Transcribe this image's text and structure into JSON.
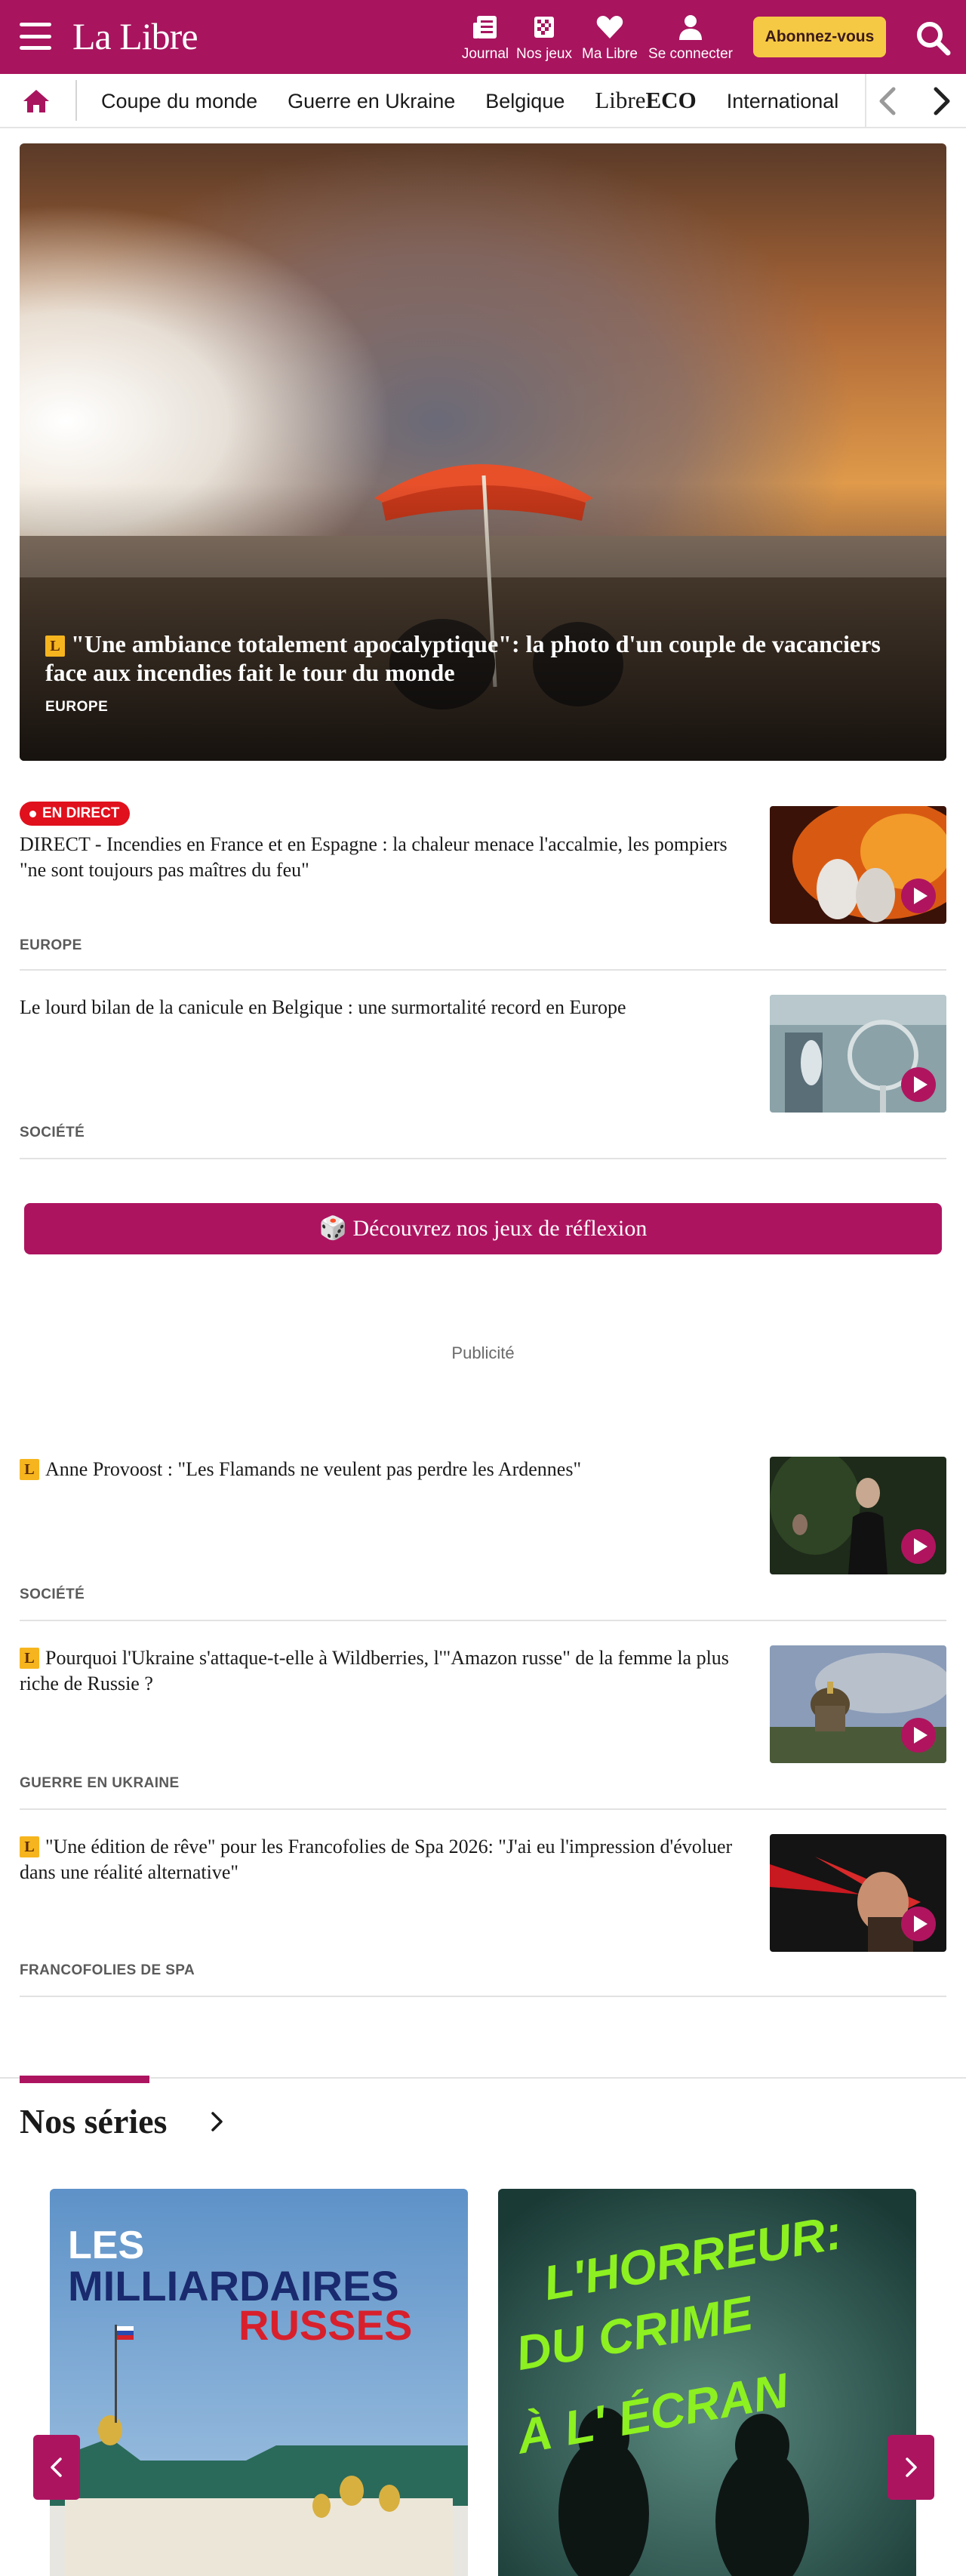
{
  "header": {
    "logo": "La Libre",
    "tools": [
      {
        "label": "Journal",
        "icon": "newspaper-icon"
      },
      {
        "label": "Nos jeux",
        "icon": "games-grid-icon"
      },
      {
        "label": "Ma Libre",
        "icon": "heart-icon"
      },
      {
        "label": "Se connecter",
        "icon": "user-icon"
      }
    ],
    "subscribe": "Abonnez-vous",
    "search_icon": "search-icon",
    "menu_icon": "hamburger-menu-icon",
    "colors": {
      "brand": "#a8145e",
      "accent": "#f6c945"
    }
  },
  "nav": {
    "home_icon": "home-icon",
    "items": [
      "Coupe du monde",
      "Guerre en Ukraine",
      "Belgique",
      "Libre",
      "ECO",
      "International"
    ],
    "prev_icon": "chevron-left-icon",
    "next_icon": "chevron-right-icon"
  },
  "hero": {
    "badge": "L",
    "title": "\"Une ambiance totalement apocalyptique\": la photo d'un couple de vacanciers face aux incendies fait le tour du monde",
    "category": "EUROPE"
  },
  "articles": [
    {
      "live": "EN DIRECT",
      "title": "DIRECT - Incendies en France et en Espagne : la chaleur menace l'accalmie, les pompiers \"ne sont toujours pas maîtres du feu\"",
      "category": "EUROPE"
    },
    {
      "title": "Le lourd bilan de la canicule en Belgique : une surmortalité record en Europe",
      "category": "SOCIÉTÉ"
    },
    {
      "badge": "L",
      "title": "Anne Provoost : \"Les Flamands ne veulent pas perdre les Ardennes\"",
      "category": "SOCIÉTÉ"
    },
    {
      "badge": "L",
      "title": "Pourquoi l'Ukraine s'attaque-t-elle à Wildberries, l'\"Amazon russe\" de la femme la plus riche de Russie ?",
      "category": "GUERRE EN UKRAINE"
    },
    {
      "badge": "L",
      "title": "\"Une édition de rêve\" pour les Francofolies de Spa 2026: \"J'ai eu l'impression d'évoluer dans une réalité alternative\"",
      "category": "FRANCOFOLIES DE SPA"
    }
  ],
  "games_button": {
    "icon": "dice-icon",
    "label": "🎲 Découvrez nos jeux de réflexion"
  },
  "ad_label": "Publicité",
  "series": {
    "title": "Nos séries",
    "cards": [
      {
        "line1": "LES",
        "line2": "MILLIARDAIRES",
        "line3": "RUSSES"
      },
      {
        "line1": "L'HORREUR:",
        "line2": "DU CRIME",
        "line3": "À L' ÉCRAN"
      }
    ]
  }
}
